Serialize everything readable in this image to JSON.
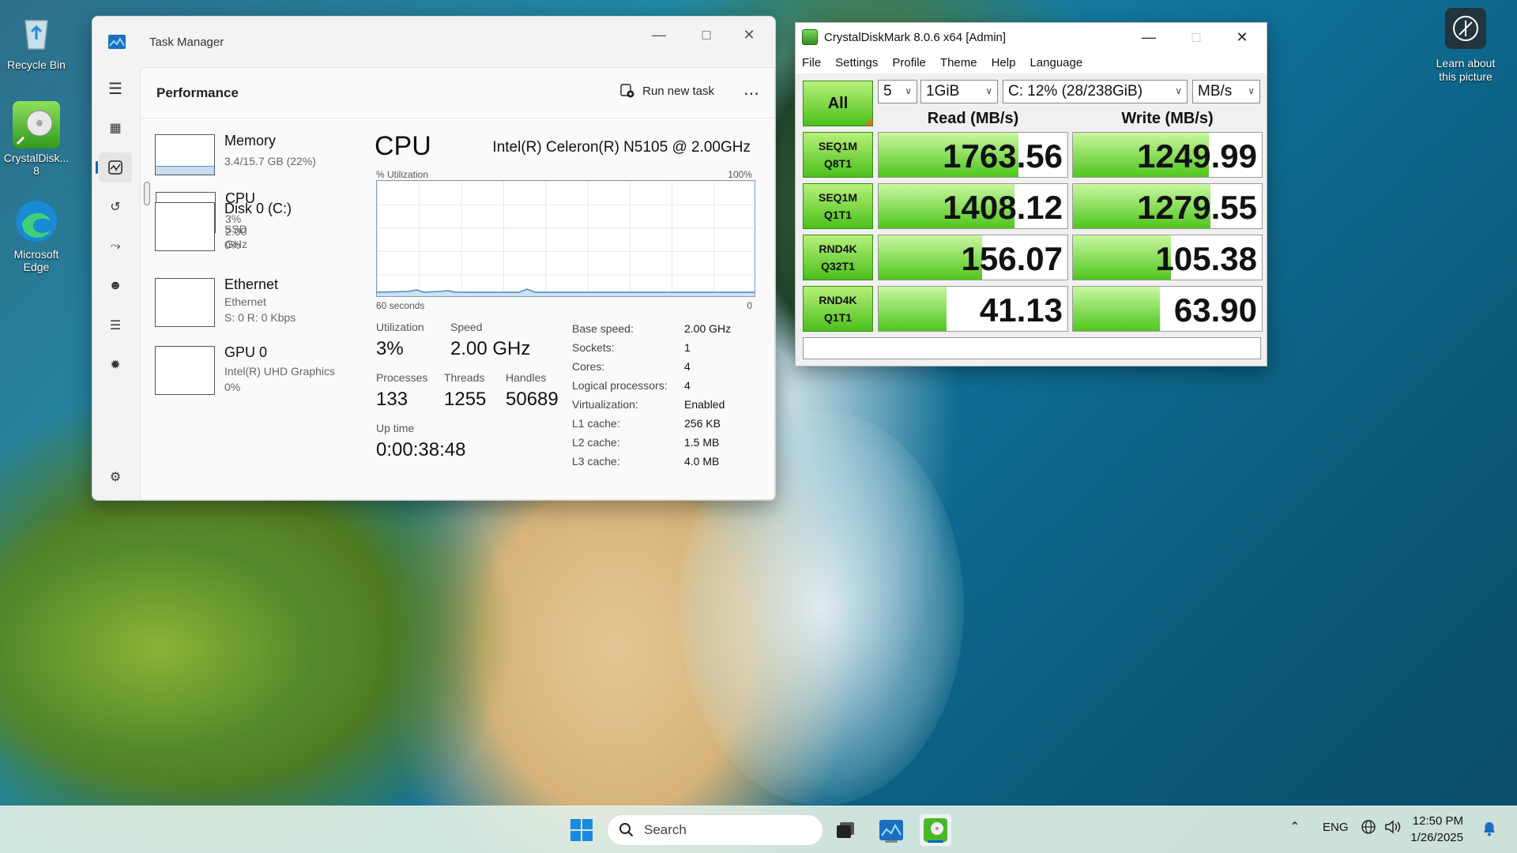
{
  "desktop": {
    "icons": [
      {
        "label": "Recycle Bin",
        "icon": "recycle-bin-icon"
      },
      {
        "label": "CrystalDisk...\n8",
        "icon": "crystaldiskmark-icon"
      },
      {
        "label": "Microsoft\nEdge",
        "icon": "edge-icon"
      }
    ],
    "learn_label": "Learn about\nthis picture"
  },
  "task_manager": {
    "title": "Task Manager",
    "page_title": "Performance",
    "run_new_task": "Run new task",
    "more": "⋯",
    "items": [
      {
        "name": "CPU",
        "sub1": "3% 2.00 GHz",
        "sub2": "",
        "sub3": ""
      },
      {
        "name": "Memory",
        "sub1": "3.4/15.7 GB (22%)",
        "sub2": "",
        "sub3": ""
      },
      {
        "name": "Disk 0 (C:)",
        "sub1": "SSD",
        "sub2": "0%",
        "sub3": ""
      },
      {
        "name": "Ethernet",
        "sub1": "Ethernet",
        "sub2": "S: 0 R: 0 Kbps",
        "sub3": ""
      },
      {
        "name": "GPU 0",
        "sub1": "Intel(R) UHD Graphics",
        "sub2": "0%",
        "sub3": ""
      }
    ],
    "memory_usage_fraction": 0.22,
    "detail": {
      "title": "CPU",
      "model": "Intel(R) Celeron(R) N5105 @ 2.00GHz",
      "graph_label_left": "% Utilization",
      "graph_label_right": "100%",
      "graph_bottom_left": "60 seconds",
      "graph_bottom_right": "0",
      "utilization_label": "Utilization",
      "utilization": "3%",
      "speed_label": "Speed",
      "speed": "2.00 GHz",
      "processes_label": "Processes",
      "processes": "133",
      "threads_label": "Threads",
      "threads": "1255",
      "handles_label": "Handles",
      "handles": "50689",
      "uptime_label": "Up time",
      "uptime": "0:00:38:48",
      "specs": [
        {
          "k": "Base speed:",
          "v": "2.00 GHz"
        },
        {
          "k": "Sockets:",
          "v": "1"
        },
        {
          "k": "Cores:",
          "v": "4"
        },
        {
          "k": "Logical processors:",
          "v": "4"
        },
        {
          "k": "Virtualization:",
          "v": "Enabled"
        },
        {
          "k": "L1 cache:",
          "v": "256 KB"
        },
        {
          "k": "L2 cache:",
          "v": "1.5 MB"
        },
        {
          "k": "L3 cache:",
          "v": "4.0 MB"
        }
      ]
    }
  },
  "cdm": {
    "title": "CrystalDiskMark 8.0.6 x64 [Admin]",
    "menu": [
      "File",
      "Settings",
      "Profile",
      "Theme",
      "Help",
      "Language"
    ],
    "all_label": "All",
    "count": "5",
    "size": "1GiB",
    "drive": "C: 12% (28/238GiB)",
    "unit": "MB/s",
    "read_header": "Read (MB/s)",
    "write_header": "Write (MB/s)",
    "rows": [
      {
        "l1": "SEQ1M",
        "l2": "Q8T1",
        "read": "1763.56",
        "write": "1249.99",
        "read_fill": 0.74,
        "write_fill": 0.72
      },
      {
        "l1": "SEQ1M",
        "l2": "Q1T1",
        "read": "1408.12",
        "write": "1279.55",
        "read_fill": 0.72,
        "write_fill": 0.73
      },
      {
        "l1": "RND4K",
        "l2": "Q32T1",
        "read": "156.07",
        "write": "105.38",
        "read_fill": 0.55,
        "write_fill": 0.52
      },
      {
        "l1": "RND4K",
        "l2": "Q1T1",
        "read": "41.13",
        "write": "63.90",
        "read_fill": 0.36,
        "write_fill": 0.46
      }
    ]
  },
  "taskbar": {
    "search_placeholder": "Search",
    "lang": "ENG",
    "time": "12:50 PM",
    "date": "1/26/2025"
  }
}
